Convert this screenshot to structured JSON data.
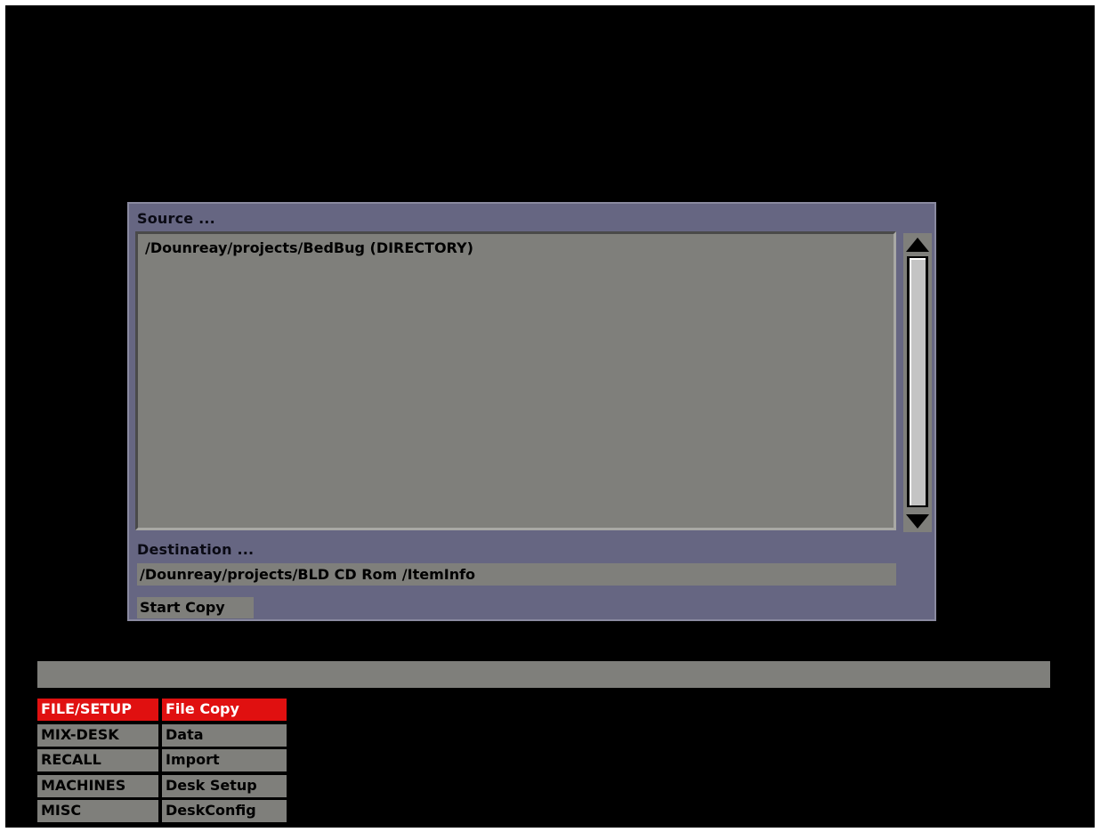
{
  "dialog": {
    "source_label": "Source ...",
    "source_items": [
      "/Dounreay/projects/BedBug  (DIRECTORY)"
    ],
    "destination_label": "Destination ...",
    "destination_value": "/Dounreay/projects/BLD  CD  Rom  /ItemInfo",
    "start_button": "Start  Copy"
  },
  "status_bar": {
    "text": ""
  },
  "main_menu": [
    "FILE/SETUP",
    "MIX-DESK",
    "RECALL",
    "MACHINES",
    "MISC"
  ],
  "sub_menu": [
    "File  Copy",
    "Data",
    "Import",
    "Desk  Setup",
    "DeskConfig"
  ],
  "active": {
    "main_menu": "FILE/SETUP",
    "sub_menu": "File  Copy"
  },
  "colors": {
    "background": "#000000",
    "panel": "#666682",
    "field": "#7f7f7b",
    "active": "#e01010"
  },
  "icons": {
    "scroll_up": "triangle-up-icon",
    "scroll_down": "triangle-down-icon"
  }
}
